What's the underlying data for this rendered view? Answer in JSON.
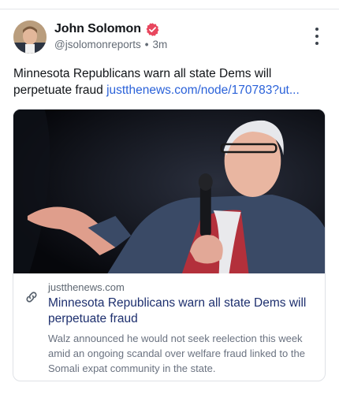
{
  "author": {
    "name": "John Solomon",
    "handle": "@jsolomonreports",
    "separator": "•",
    "time": "3m"
  },
  "post": {
    "text": "Minnesota Republicans warn all state Dems will perpetuate fraud ",
    "link": "justthenews.com/node/170783?ut..."
  },
  "card": {
    "domain": "justthenews.com",
    "title": "Minnesota Republicans warn all state Dems will perpetuate fraud",
    "description": "Walz announced he would not seek reelection this week amid an ongoing scandal over welfare fraud linked to the Somali expat community in the state."
  },
  "icons": {
    "verified": "verified-badge-icon",
    "more": "more-vertical-icon",
    "link": "link-icon"
  },
  "colors": {
    "verified_badge": "#e8475e",
    "link": "#2b62d9",
    "card_title": "#1d2f6e"
  }
}
